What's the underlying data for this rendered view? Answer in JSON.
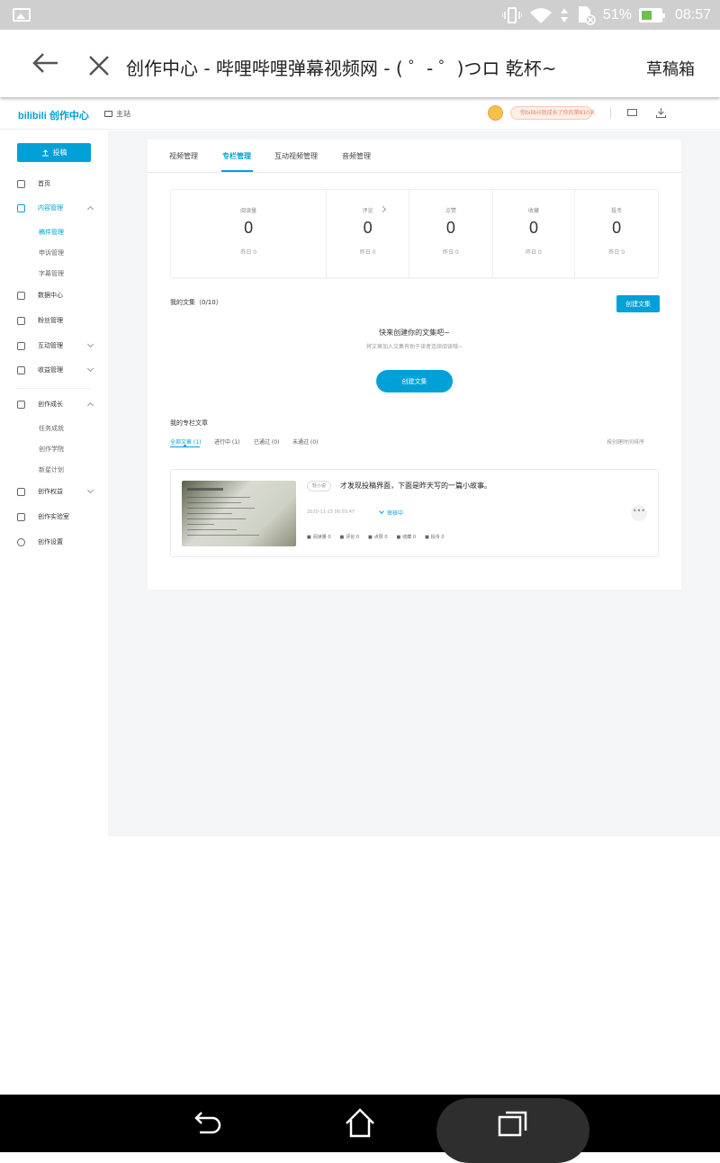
{
  "status_bar": {
    "battery": "51%",
    "time": "08:57"
  },
  "browser": {
    "title": "创作中心 - 哔哩哔哩弹幕视频网 - ( ゜- ゜)つロ 乾杯~",
    "draft_box": "草稿箱"
  },
  "header": {
    "logo": "bilibili 创作中心",
    "home": "主站",
    "promo": "你bilibili就成长了你的第810天"
  },
  "sidebar": {
    "publish": "投稿",
    "items": {
      "home": "首页",
      "content": "内容管理",
      "data": "数据中心",
      "fans": "粉丝管理",
      "interaction": "互动管理",
      "income": "收益管理",
      "growth": "创作成长",
      "rights": "创作权益",
      "lab": "创作实验室",
      "settings": "创作设置"
    },
    "sub": {
      "drafts": "稿件管理",
      "appeals": "申诉管理",
      "subtitles": "字幕管理",
      "tasks": "任务成就",
      "academy": "创作学院",
      "newstar": "新星计划"
    }
  },
  "tabs": [
    "视频管理",
    "专栏管理",
    "互动视频管理",
    "音频管理"
  ],
  "stats": [
    {
      "label": "阅读量",
      "value": "0",
      "yesterday": "昨日  0"
    },
    {
      "label": "评论",
      "value": "0",
      "yesterday": "昨日  0"
    },
    {
      "label": "点赞",
      "value": "0",
      "yesterday": "昨日  0"
    },
    {
      "label": "收藏",
      "value": "0",
      "yesterday": "昨日  0"
    },
    {
      "label": "投币",
      "value": "0",
      "yesterday": "昨日  0"
    }
  ],
  "collections": {
    "title": "我的文集（0/10）",
    "create": "创建文集",
    "empty_title": "快来创建你的文集吧~",
    "empty_sub": "将文章加入文集有助于读者连续阅读哦~",
    "create2": "创建文集"
  },
  "articles": {
    "title": "我的专栏文章",
    "filters": [
      "全部文章 (1)",
      "进行中 (1)",
      "已通过 (0)",
      "未通过 (0)"
    ],
    "sort": "按创建时间排序",
    "item": {
      "tag": "轻小说",
      "title": "才发现投稿界面，下面是昨天写的一篇小故事。",
      "time": "2020-11-15 06:55:47",
      "status": "审核中",
      "more": "•••",
      "metrics": [
        "阅读量 0",
        "评论 0",
        "点赞 0",
        "收藏 0",
        "投币 0"
      ]
    }
  }
}
